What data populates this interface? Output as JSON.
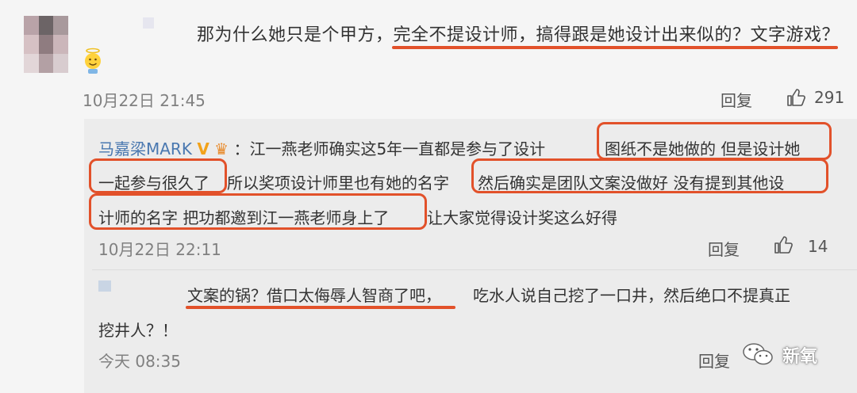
{
  "comment": {
    "text": "那为什么她只是个甲方，完全不提设计师，搞得跟是她设计出来似的？文字游戏？",
    "date": "10月22日 21:45",
    "reply_label": "回复",
    "likes": "291"
  },
  "reply1": {
    "user": "马嘉梁MARK",
    "line1_a": "：江一燕老师确实这5年一直都是参与了设计",
    "line1_b": "图纸不是她做的 但是设计她",
    "line2_a": "一起参与很久了",
    "line2_b": "所以奖项设计师里也有她的名字",
    "line2_c": "然后确实是团队文案没做好 没有提到其他设",
    "line3_a": "计师的名字 把功都邀到江一燕老师身上了",
    "line3_b": "让大家觉得设计奖这么好得",
    "date": "10月22日 22:11",
    "reply_label": "回复",
    "likes": "14"
  },
  "reply2": {
    "line1_a": "文案的锅？借口太侮辱人智商了吧，",
    "line1_b": "吃水人说自己挖了一口井，然后绝口不提真正",
    "line2": "挖井人？！",
    "date": "今天 08:35",
    "reply_label": "回复"
  },
  "watermark": {
    "text": "新氧"
  },
  "colors": {
    "highlight": "#e2512a",
    "username": "#4a78b0"
  }
}
